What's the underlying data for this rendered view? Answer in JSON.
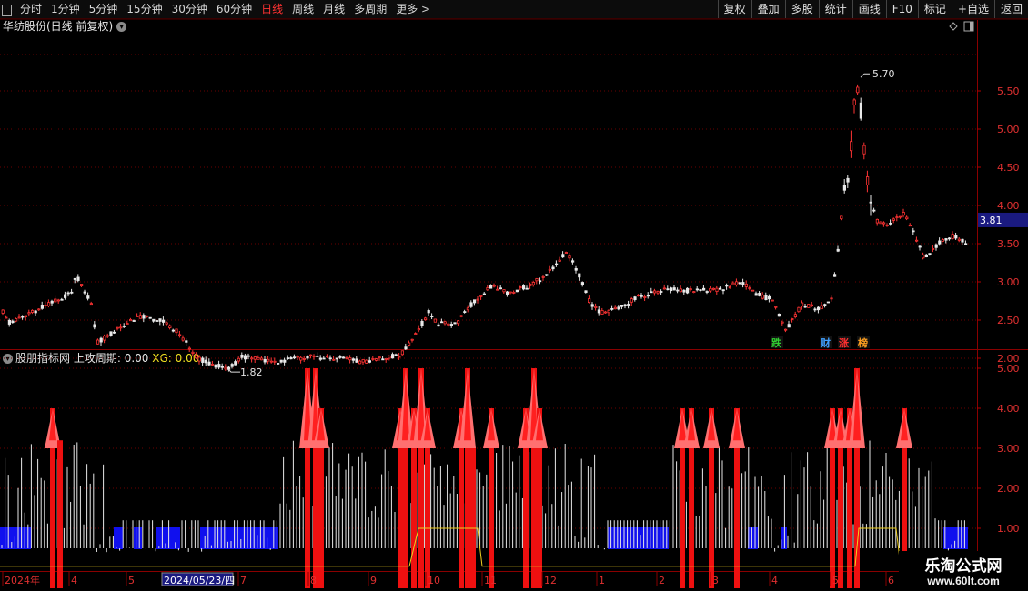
{
  "toolbar": {
    "timeframes": [
      {
        "label": "分时",
        "active": false
      },
      {
        "label": "1分钟",
        "active": false
      },
      {
        "label": "5分钟",
        "active": false
      },
      {
        "label": "15分钟",
        "active": false
      },
      {
        "label": "30分钟",
        "active": false
      },
      {
        "label": "60分钟",
        "active": false
      },
      {
        "label": "日线",
        "active": true
      },
      {
        "label": "周线",
        "active": false
      },
      {
        "label": "月线",
        "active": false
      },
      {
        "label": "多周期",
        "active": false
      },
      {
        "label": "更多 >",
        "active": false
      }
    ],
    "actions": [
      "复权",
      "叠加",
      "多股",
      "统计",
      "画线",
      "F10",
      "标记",
      "+自选",
      "返回"
    ]
  },
  "main_chart": {
    "title": "华纺股份(日线 前复权)",
    "y_ticks": [
      "5.50",
      "5.00",
      "4.50",
      "4.00",
      "3.50",
      "3.00",
      "2.50",
      "2.00"
    ],
    "current_price": "3.81",
    "high_label": "5.70",
    "low_label": "1.82",
    "markers": [
      {
        "text": "跌",
        "color": "#30d030"
      },
      {
        "text": "财",
        "color": "#40a0ff"
      },
      {
        "text": "涨",
        "color": "#ff3030"
      },
      {
        "text": "榜",
        "color": "#ffa020"
      }
    ]
  },
  "indicator": {
    "name": "股朋指标网",
    "line1": "上攻周期: 0.00",
    "line2": "XG: 0.00",
    "y_ticks": [
      "5.00",
      "4.00",
      "3.00",
      "2.00",
      "1.00"
    ]
  },
  "x_axis": {
    "labels": [
      "2024年",
      "4",
      "5",
      "2024/05/23/四",
      "7",
      "8",
      "9",
      "10",
      "11",
      "12",
      "1",
      "2",
      "3",
      "4",
      "5",
      "6"
    ]
  },
  "watermark": {
    "line1": "乐淘公式网",
    "line2": "www.60lt.com"
  },
  "chart_data": {
    "type": "candlestick",
    "price_range": [
      1.82,
      5.7
    ],
    "key_points": [
      {
        "x": "2024-01",
        "close": 2.65
      },
      {
        "x": "2024-03",
        "close": 2.9
      },
      {
        "x": "2024-04",
        "close": 2.1
      },
      {
        "x": "2024-05",
        "close": 2.55
      },
      {
        "x": "2024-06",
        "close": 1.82
      },
      {
        "x": "2024-08",
        "close": 1.95
      },
      {
        "x": "2024-09",
        "close": 2.4
      },
      {
        "x": "2024-10",
        "close": 3.0
      },
      {
        "x": "2024-11",
        "close": 3.2
      },
      {
        "x": "2024-12",
        "close": 3.42
      },
      {
        "x": "2025-01",
        "close": 2.6
      },
      {
        "x": "2025-02",
        "close": 2.9
      },
      {
        "x": "2025-03",
        "close": 3.0
      },
      {
        "x": "2025-04",
        "close": 2.7
      },
      {
        "x": "2025-05",
        "close": 5.7
      },
      {
        "x": "2025-06",
        "close": 3.5
      }
    ],
    "indicator_range": [
      0,
      5
    ]
  }
}
